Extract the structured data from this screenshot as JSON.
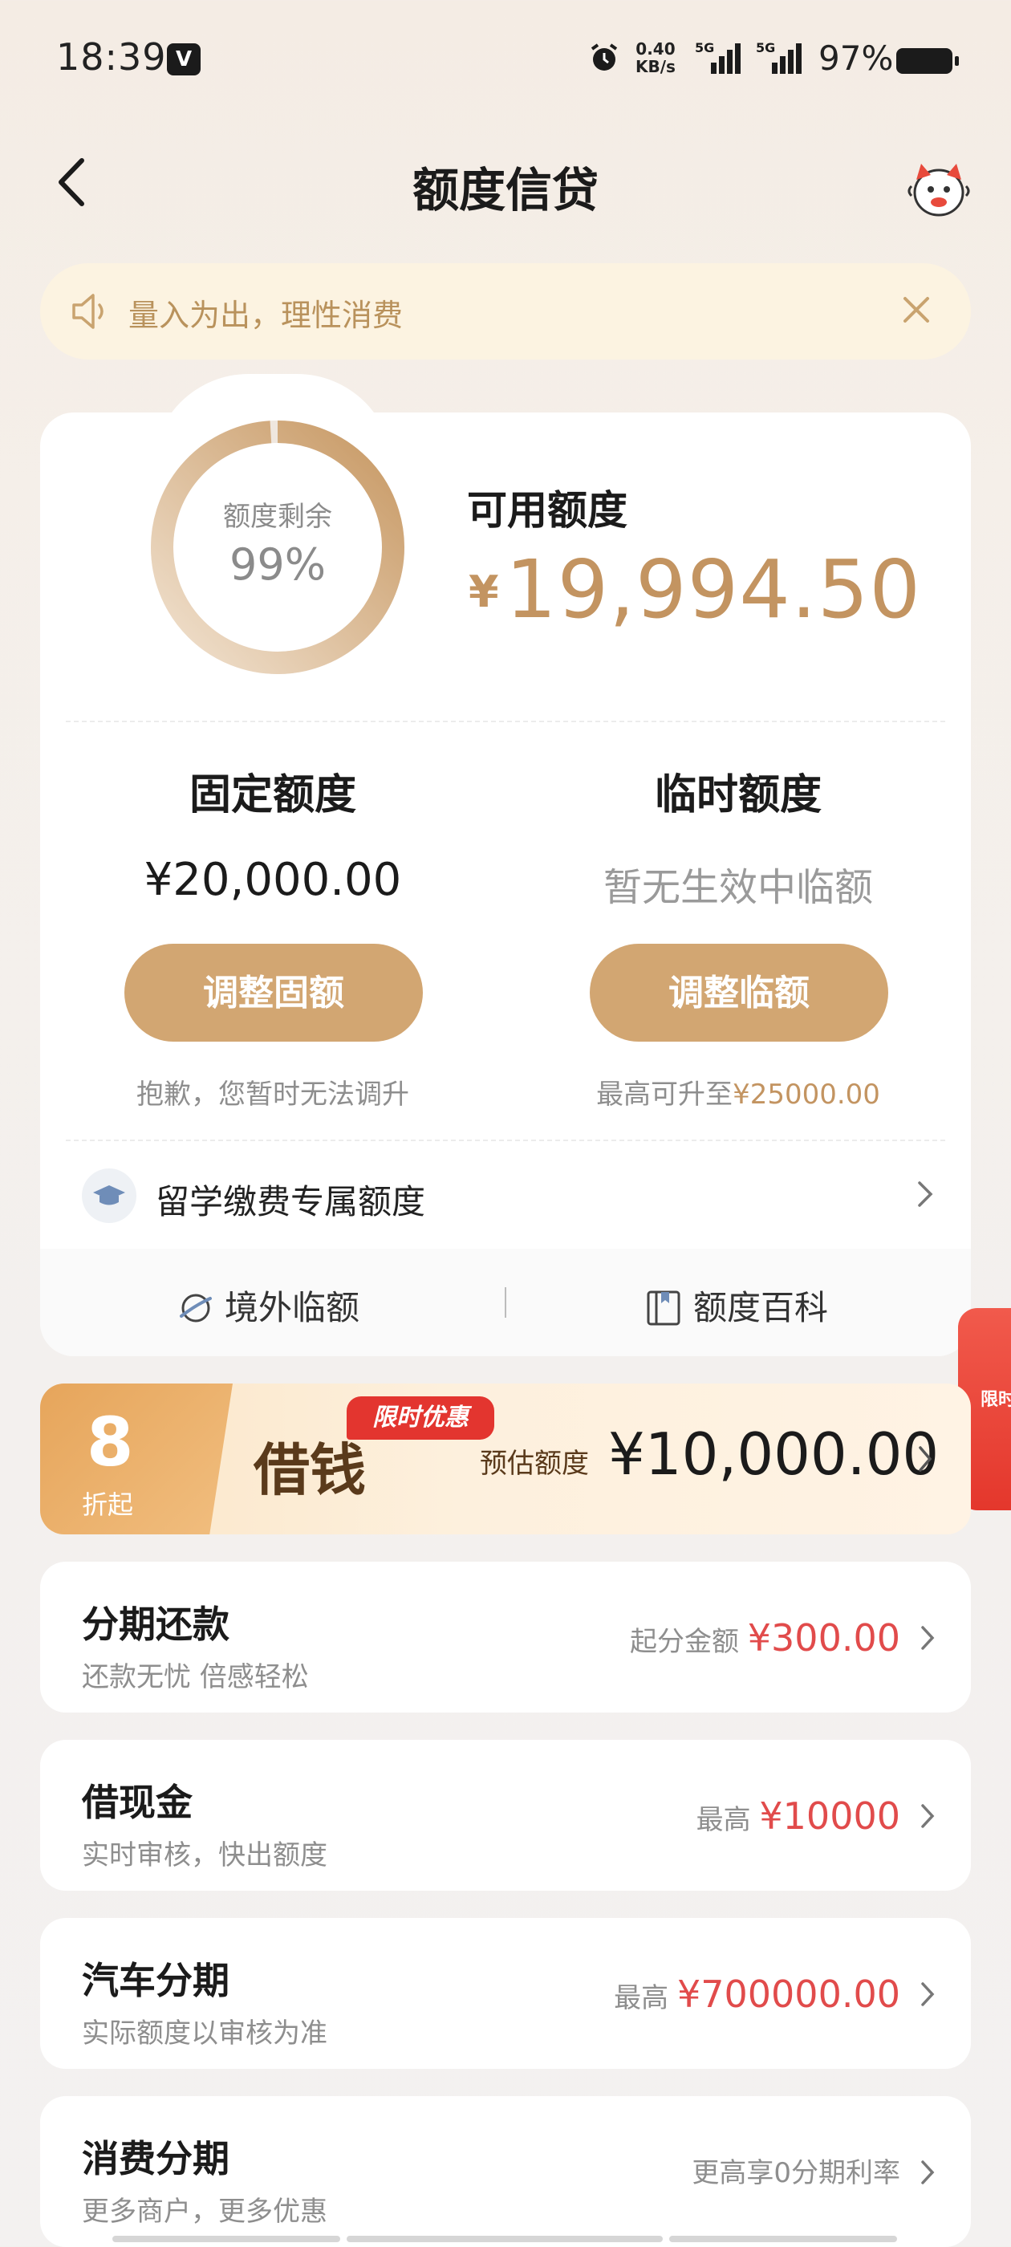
{
  "status_bar": {
    "time": "18:39",
    "app_badge": "V",
    "net_speed_value": "0.40",
    "net_speed_unit": "KB/s",
    "signal1_label": "5G",
    "signal2_label": "5G",
    "battery": "97%"
  },
  "nav": {
    "title": "额度信贷"
  },
  "notice": {
    "text": "量入为出，理性消费"
  },
  "credit": {
    "ring_label": "额度剩余",
    "ring_percent_text": "99%",
    "ring_percent": 0.99,
    "available_label": "可用额度",
    "available_currency": "¥",
    "available_amount": "19,994.50",
    "fixed": {
      "title": "固定额度",
      "value": "¥20,000.00",
      "button": "调整固额",
      "note": "抱歉，您暂时无法调升"
    },
    "temp": {
      "title": "临时额度",
      "value": "暂无生效中临额",
      "button": "调整临额",
      "note_prefix": "最高可升至",
      "note_amount": "¥25000.00"
    },
    "study_label": "留学缴费专属额度",
    "links": {
      "overseas": "境外临额",
      "wiki": "额度百科"
    }
  },
  "side_tab": {
    "text": "限时"
  },
  "banner": {
    "discount_number": "8",
    "discount_sub": "折起",
    "tag": "限时优惠",
    "title": "借钱",
    "estimate_label": "预估额度",
    "estimate_amount": "¥10,000.00"
  },
  "products": [
    {
      "title": "分期还款",
      "subtitle": "还款无忧 倍感轻松",
      "right_label": "起分金额",
      "right_value": "¥300.00"
    },
    {
      "title": "借现金",
      "subtitle": "实时审核，快出额度",
      "right_label": "最高",
      "right_value": "¥10000"
    },
    {
      "title": "汽车分期",
      "subtitle": "实际额度以审核为准",
      "right_label": "最高",
      "right_value": "¥700000.00"
    },
    {
      "title": "消费分期",
      "subtitle": "更多商户，更多优惠",
      "right_label": "更高享0分期利率",
      "right_value": ""
    }
  ],
  "colors": {
    "accent_gold": "#c39461",
    "button_gold": "#d2a672",
    "price_red": "#e14b4b",
    "tag_red": "#e3352f"
  }
}
